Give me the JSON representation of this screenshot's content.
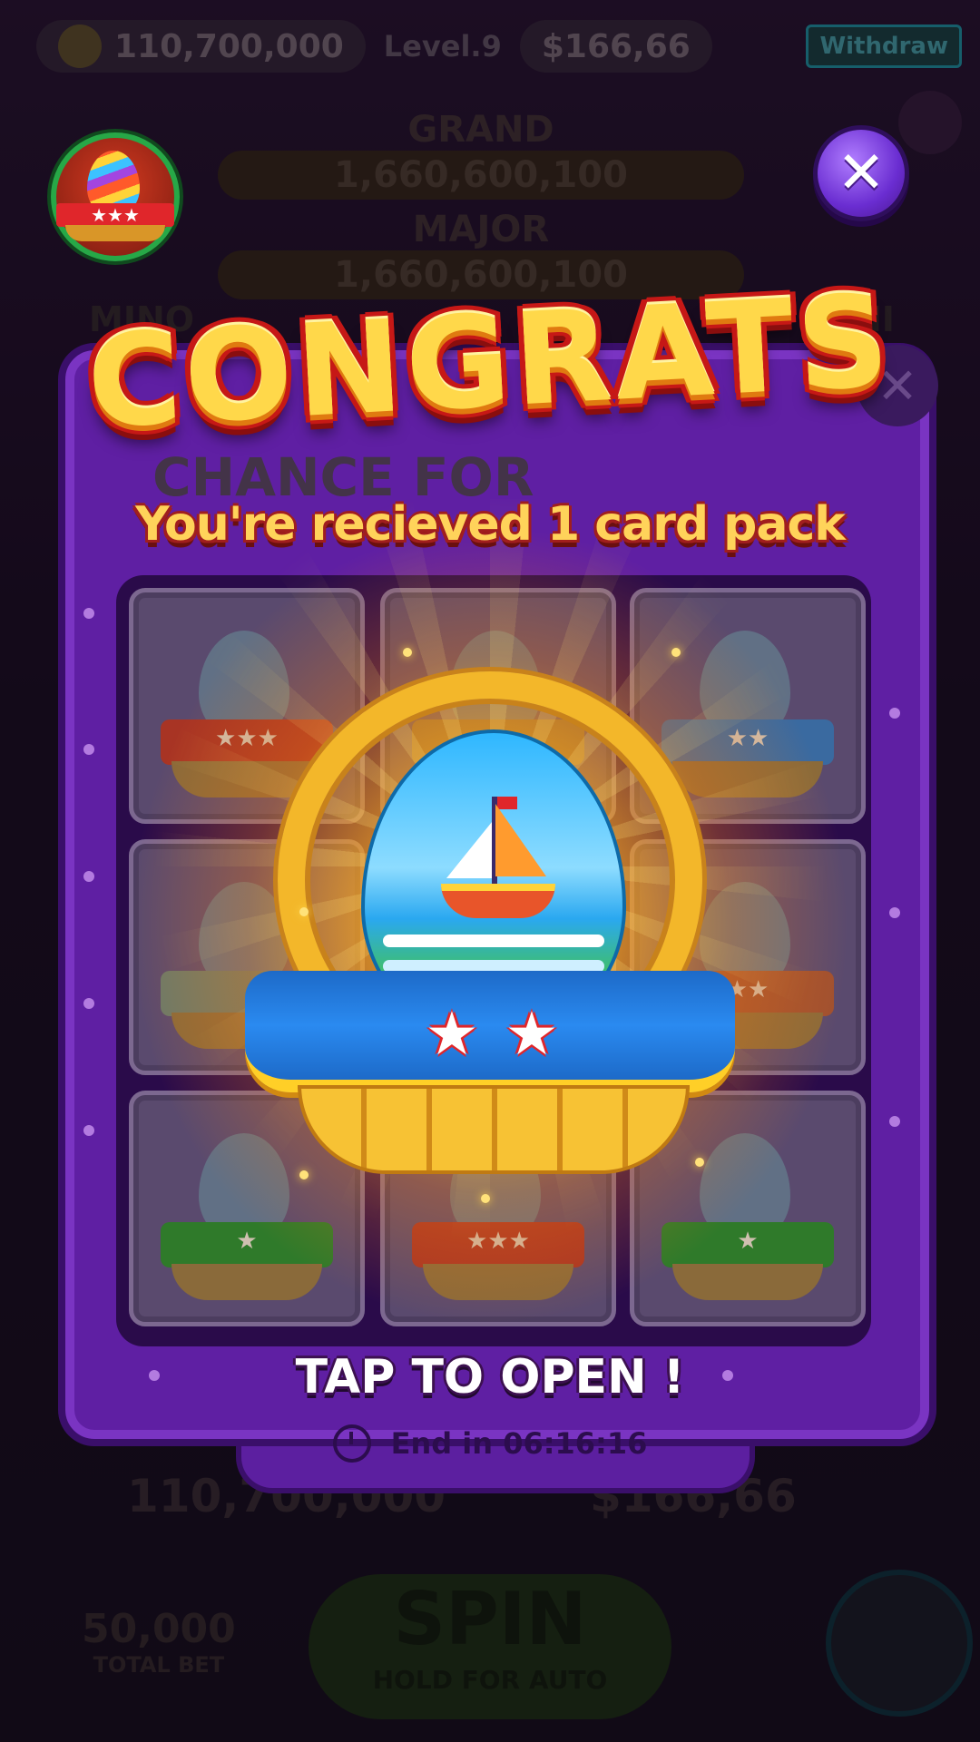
{
  "background": {
    "top_bar": {
      "coins": "110,700,000",
      "level": "Level.9",
      "cash": "$166,66",
      "withdraw_label": "Withdraw"
    },
    "jackpots": [
      {
        "label": "GRAND",
        "value": "1,660,600,100"
      },
      {
        "label": "MAJOR",
        "value": "1,660,600,100"
      }
    ],
    "side_labels": {
      "left": "MINO",
      "right": "MINI"
    },
    "bottom": {
      "balance": "110,700,000",
      "cash": "$166,66",
      "bet_value": "50,000",
      "bet_label": "TOTAL BET",
      "spin_label": "SPIN",
      "spin_sub": "HOLD FOR AUTO"
    }
  },
  "popup": {
    "title": "CONGRATS",
    "ghost_text": "CHANCE FOR",
    "subtitle": "You're recieved 1 card pack",
    "action": "TAP TO OPEN !",
    "timer": "End in 06:16:16",
    "close_icon": "close-icon",
    "reward": {
      "item": "egg-basket",
      "stars": 2,
      "theme": "sailboat"
    },
    "grid_cells": [
      {
        "stars": 3,
        "cloth": "#a83424"
      },
      {
        "stars": 0,
        "cloth": "#8a6a3a"
      },
      {
        "stars": 2,
        "cloth": "#3a6aa0"
      },
      {
        "stars": 0,
        "cloth": "#6a7a6a"
      },
      {
        "stars": 0,
        "cloth": "#8a6a3a"
      },
      {
        "stars": 2,
        "cloth": "#a05030"
      },
      {
        "stars": 1,
        "cloth": "#2f7a2a"
      },
      {
        "stars": 3,
        "cloth": "#a83424"
      },
      {
        "stars": 1,
        "cloth": "#2f7a2a"
      }
    ]
  },
  "colors": {
    "frame": "#5f1fa3",
    "title_fill": "#ffd84a",
    "title_outline": "#c61816",
    "glow": "#ffce3c"
  }
}
